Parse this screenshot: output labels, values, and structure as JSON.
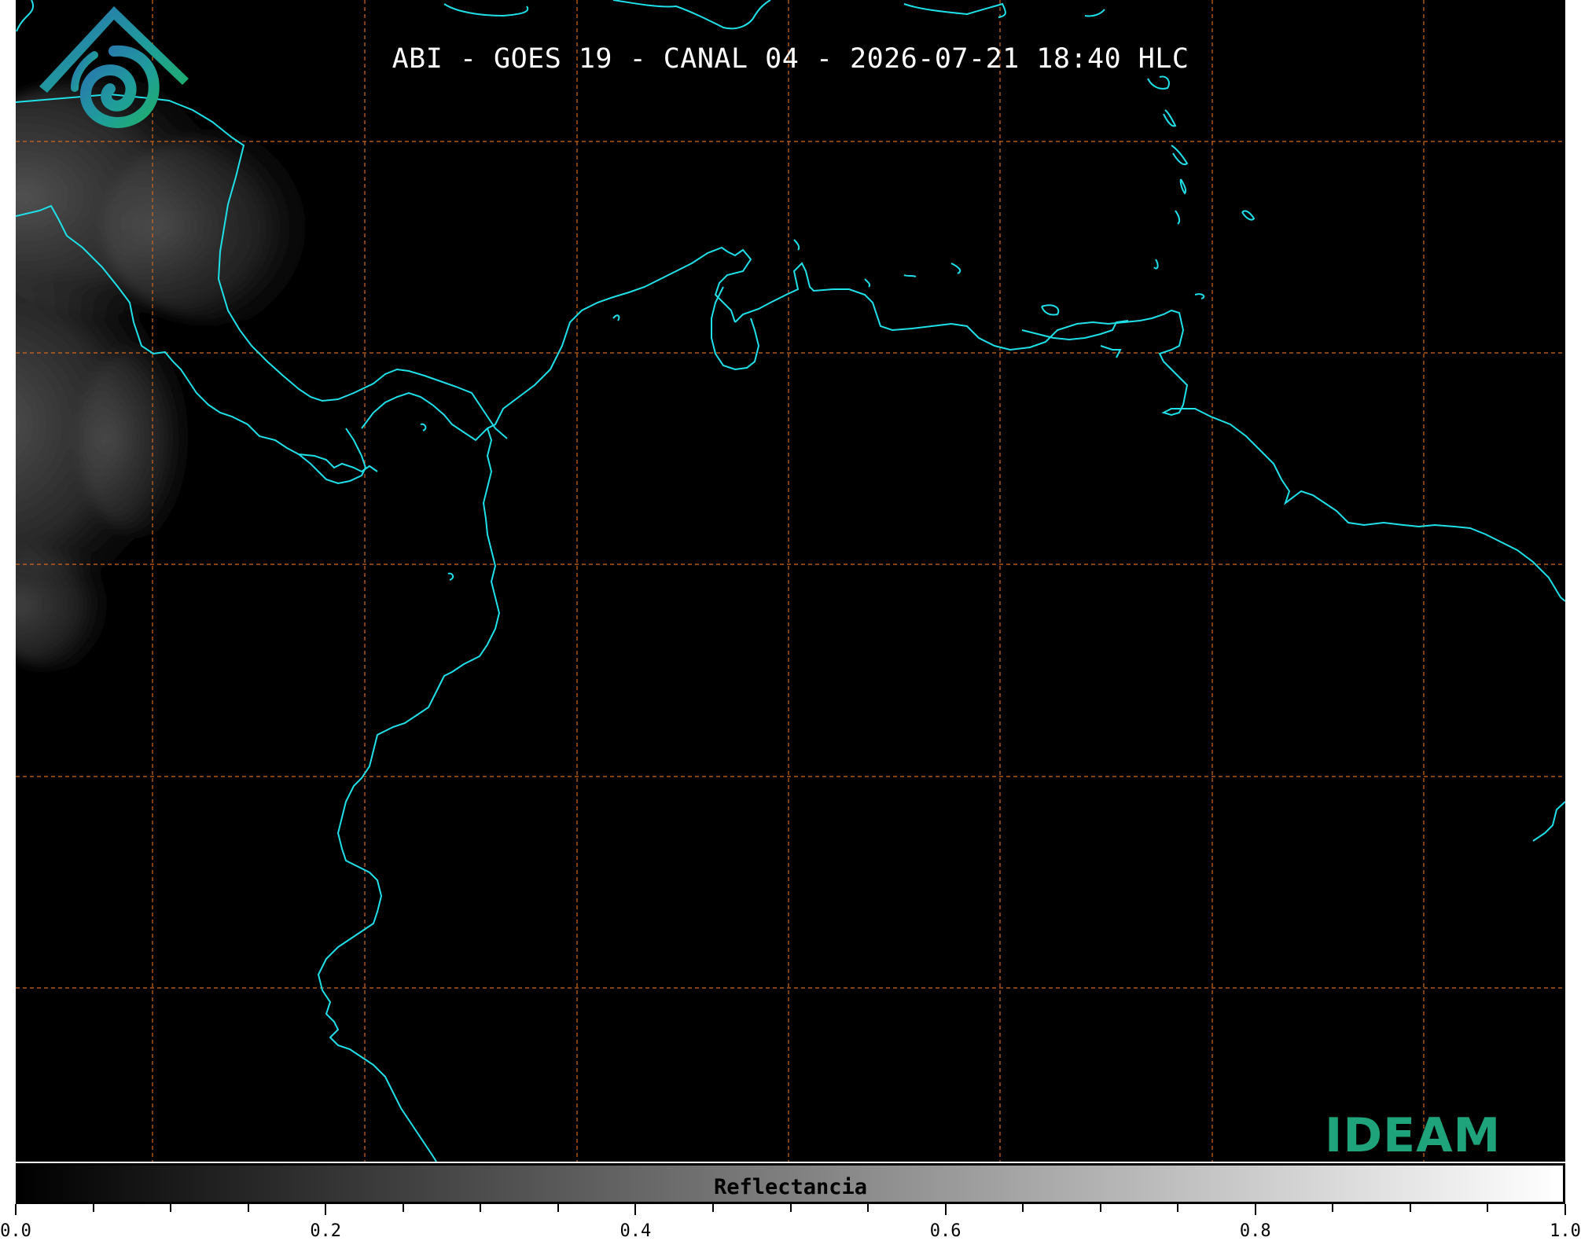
{
  "title": "ABI - GOES 19 - CANAL 04 - 2026-07-21 18:40 HLC",
  "colorbar": {
    "label": "Reflectancia",
    "min": 0.0,
    "max": 1.0,
    "colormap": "grayscale black-to-white",
    "tick_labels": [
      "0.0",
      "0.2",
      "0.4",
      "0.6",
      "0.8",
      "1.0"
    ],
    "tick_values": [
      0.0,
      0.2,
      0.4,
      0.6,
      0.8,
      1.0
    ],
    "minor_tick_step": 0.05
  },
  "logo": {
    "text": "IDEAM",
    "icon": "ideam-mountain-spiral-logo"
  },
  "colors": {
    "coastline": "#1fe0e8",
    "gridlines": "#d2691e",
    "background": "#000000",
    "logo_text": "#1fa37a",
    "title_text": "#ffffff"
  },
  "map": {
    "gridlines": "dashed",
    "features": [
      "coastlines",
      "cloud-cover-west"
    ]
  }
}
